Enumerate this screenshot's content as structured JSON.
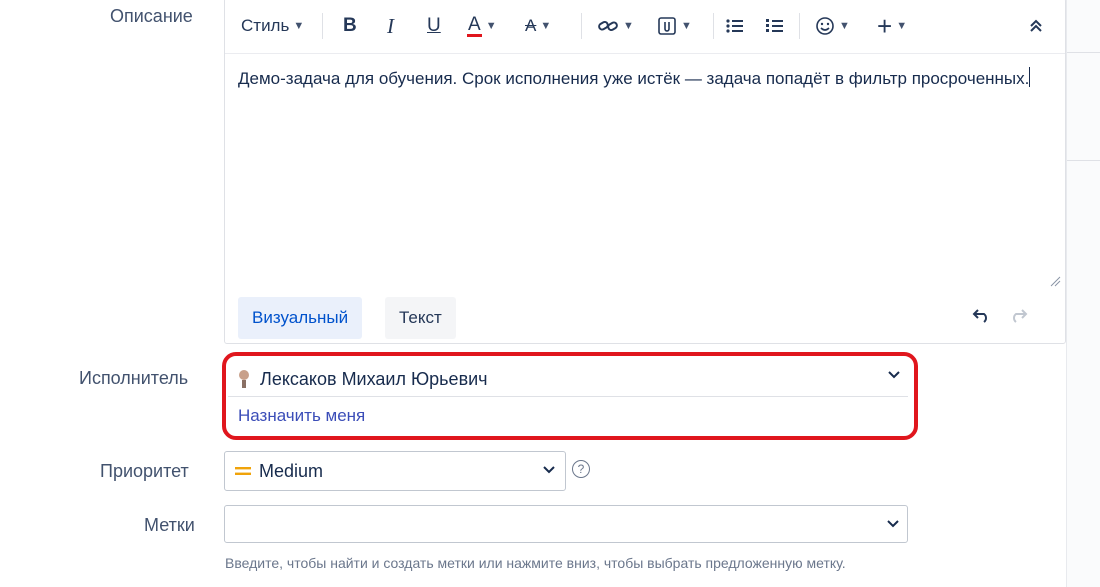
{
  "fields": {
    "description_label": "Описание",
    "assignee_label": "Исполнитель",
    "priority_label": "Приоритет",
    "labels_label": "Метки"
  },
  "toolbar": {
    "style_label": "Стиль",
    "icons": [
      "bold-icon",
      "italic-icon",
      "underline-icon",
      "text-color-icon",
      "clear-format-icon",
      "link-icon",
      "attachment-icon",
      "bullet-list-icon",
      "numbered-list-icon",
      "emoji-icon",
      "plus-icon",
      "collapse-icon"
    ],
    "text_color": "#e0161d"
  },
  "editor": {
    "text": "Демо-задача для обучения. Срок исполнения уже истёк — задача попадёт в фильтр просроченных.",
    "tab_visual": "Визуальный",
    "tab_text": "Текст"
  },
  "assignee": {
    "value": "Лексаков Михаил Юрьевич",
    "assign_me": "Назначить меня"
  },
  "priority": {
    "value": "Medium",
    "color": "#f0a30a"
  },
  "labels": {
    "hint": "Введите, чтобы найти и создать метки или нажмите вниз, чтобы выбрать предложенную метку."
  },
  "colors": {
    "highlight": "#e0161d",
    "link": "#3b4db8"
  }
}
